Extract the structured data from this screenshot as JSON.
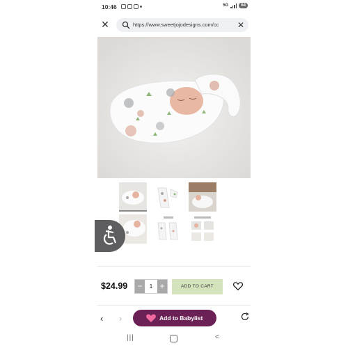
{
  "status_bar": {
    "time": "10:46",
    "network": "5G",
    "battery": "64"
  },
  "url_bar": {
    "url": "https://www.sweetjojodesigns.com/cc",
    "close_icon": "close-icon",
    "search_icon": "search-icon",
    "clear_icon": "close-icon"
  },
  "product": {
    "price": "$24.99",
    "quantity": "1",
    "qty_minus": "−",
    "qty_plus": "+",
    "add_to_cart": "ADD TO CART"
  },
  "bottom_bar": {
    "babylist_label": "Add to Babylist",
    "back_glyph": "‹",
    "forward_glyph": "›"
  },
  "sys_nav": {
    "recent_glyph": "|||",
    "back_glyph": "<"
  },
  "colors": {
    "add_to_cart_bg": "#d5e3bd",
    "babylist_bg": "#6b2155",
    "accessibility_bg": "#5e5e60"
  }
}
